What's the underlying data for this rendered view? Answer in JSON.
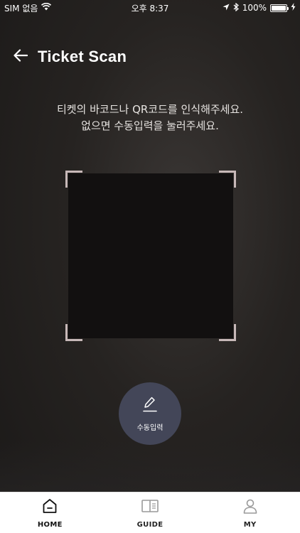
{
  "status_bar": {
    "carrier": "SIM 없음",
    "time": "오후 8:37",
    "battery": "100%"
  },
  "header": {
    "title": "Ticket Scan"
  },
  "instructions": {
    "line1": "티켓의 바코드나 QR코드를 인식해주세요.",
    "line2": "없으면 수동입력을 눌러주세요."
  },
  "manual_entry": {
    "label": "수동입력"
  },
  "tabs": [
    {
      "label": "HOME",
      "icon": "home-icon",
      "active": true
    },
    {
      "label": "GUIDE",
      "icon": "book-icon",
      "active": false
    },
    {
      "label": "MY",
      "icon": "person-icon",
      "active": false
    }
  ],
  "colors": {
    "manual_button_bg": "#434658",
    "scan_corner": "#c7b8b8"
  }
}
